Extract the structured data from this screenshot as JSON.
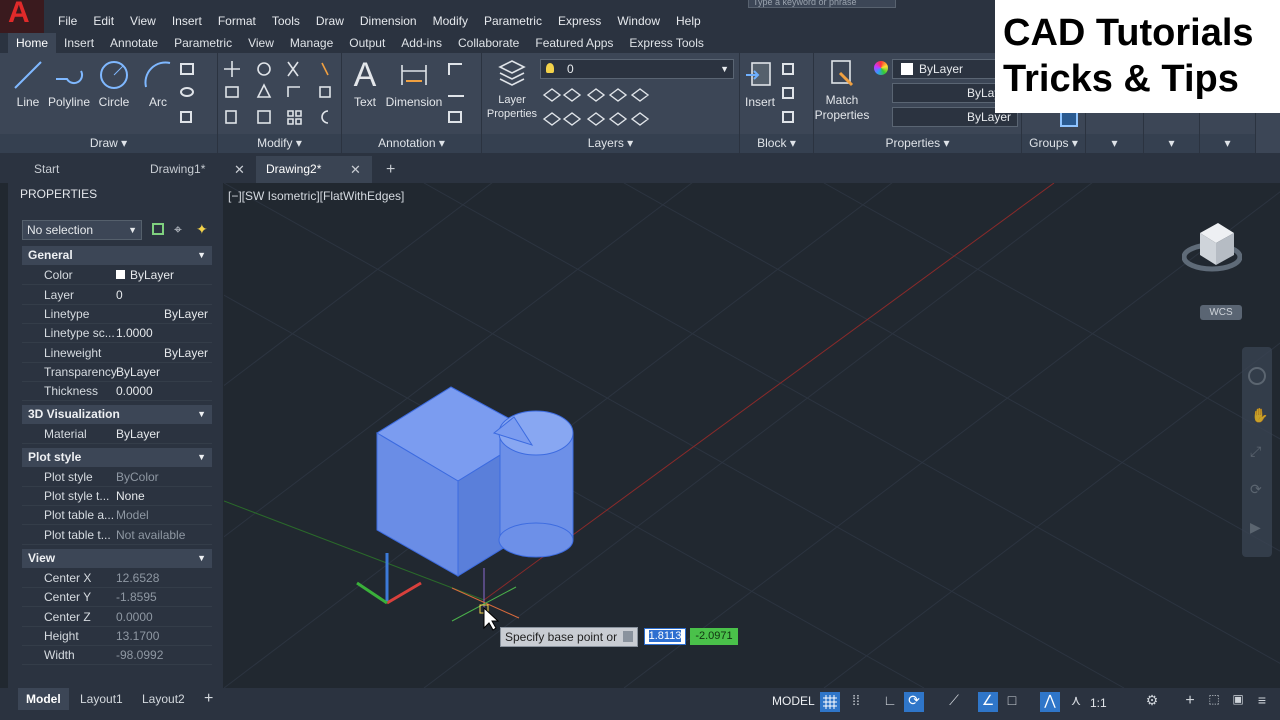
{
  "menu": [
    "File",
    "Edit",
    "View",
    "Insert",
    "Format",
    "Tools",
    "Draw",
    "Dimension",
    "Modify",
    "Parametric",
    "Express",
    "Window",
    "Help"
  ],
  "search_placeholder": "Type a keyword or phrase",
  "ribbon_tabs": [
    "Home",
    "Insert",
    "Annotate",
    "Parametric",
    "View",
    "Manage",
    "Output",
    "Add-ins",
    "Collaborate",
    "Featured Apps",
    "Express Tools"
  ],
  "draw": {
    "title": "Draw",
    "line": "Line",
    "polyline": "Polyline",
    "circle": "Circle",
    "arc": "Arc"
  },
  "modify": {
    "title": "Modify"
  },
  "annotation": {
    "title": "Annotation",
    "text": "Text",
    "dimension": "Dimension"
  },
  "layers": {
    "title": "Layers",
    "layer_properties": "Layer Properties",
    "current_layer": "0"
  },
  "block": {
    "title": "Block",
    "insert": "Insert"
  },
  "properties_panel": {
    "title": "Properties",
    "match": "Match Properties",
    "color": "ByLayer",
    "linetype": "ByLayer",
    "lineweight": "ByLayer"
  },
  "groups": {
    "title": "Groups"
  },
  "brand": {
    "line1": "CAD Tutorials",
    "line2": "Tricks & Tips"
  },
  "doc_tabs": [
    "Start",
    "Drawing1*",
    "Drawing2*"
  ],
  "props": {
    "title": "PROPERTIES",
    "selection": "No selection",
    "sections": [
      {
        "name": "General",
        "rows": [
          [
            "Color",
            "ByLayer"
          ],
          [
            "Layer",
            "0"
          ],
          [
            "Linetype",
            "ByLayer"
          ],
          [
            "Linetype sc...",
            "1.0000"
          ],
          [
            "Lineweight",
            "ByLayer"
          ],
          [
            "Transparency",
            "ByLayer"
          ],
          [
            "Thickness",
            "0.0000"
          ]
        ]
      },
      {
        "name": "3D Visualization",
        "rows": [
          [
            "Material",
            "ByLayer"
          ]
        ]
      },
      {
        "name": "Plot style",
        "rows": [
          [
            "Plot style",
            "ByColor"
          ],
          [
            "Plot style t...",
            "None"
          ],
          [
            "Plot table a...",
            "Model"
          ],
          [
            "Plot table t...",
            "Not available"
          ]
        ]
      },
      {
        "name": "View",
        "rows": [
          [
            "Center X",
            "12.6528"
          ],
          [
            "Center Y",
            "-1.8595"
          ],
          [
            "Center Z",
            "0.0000"
          ],
          [
            "Height",
            "13.1700"
          ],
          [
            "Width",
            "-98.0992"
          ]
        ]
      }
    ]
  },
  "viewport": {
    "label": "[−][SW Isometric][FlatWithEdges]",
    "wcs": "WCS"
  },
  "prompt": {
    "text": "Specify base point or",
    "x": "1.8113",
    "y": "-2.0971"
  },
  "layout_tabs": [
    "Model",
    "Layout1",
    "Layout2"
  ],
  "status": {
    "model": "MODEL",
    "scale": "1:1"
  }
}
